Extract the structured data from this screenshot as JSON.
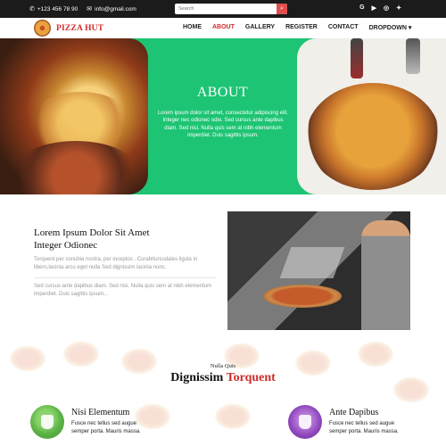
{
  "topbar": {
    "phone": "+123 456 78 90",
    "email": "info@gmail.com",
    "search_placeholder": "Search",
    "social": [
      "G",
      "▶",
      "◎",
      "✦"
    ]
  },
  "brand": {
    "name": "PIZZA HUT"
  },
  "nav": {
    "items": [
      "HOME",
      "ABOUT",
      "GALLERY",
      "REGISTER",
      "CONTACT",
      "DROPDOWN"
    ],
    "active": "ABOUT"
  },
  "hero": {
    "title": "ABOUT",
    "text": "Lorem ipsum dolor sit amet, consectetur adipiscing elit. Integer nec odionec odio. Sed cursus ante dapibus diam. Sed nisi. Nulla quis sem at nibh elementum imperdiet. Duis sagittis ipsum."
  },
  "about": {
    "heading_line1": "Lorem Ipsum Dolor Sit Amet",
    "heading_line2": "Integer Odionec",
    "para1": "Torquent per conubia nostra, per inceptos . Curabitursodales ligula in libero,lacinia arcu eget nulla Sed dignissim lacinia nunc.",
    "para2": "Sed cursus ante dapibus diam. Sed nisi. Nulla quis sem at nibh elementum imperdiet. Duis sagittis ipsum..."
  },
  "section2": {
    "kicker": "Nulla Quis",
    "title_main": "Dignissim ",
    "title_accent": "Torquent",
    "features": [
      {
        "title": "Nisi Elementum",
        "text": "Fusce nec tellus sed augue semper porta. Mauris massa."
      },
      {
        "title": "Ante Dapibus",
        "text": "Fusce nec tellus sed augue semper porta. Mauris massa."
      }
    ]
  },
  "colors": {
    "accent_red": "#d12b2b",
    "hero_green": "#1dc473",
    "topbar_bg": "#1b1b1b"
  }
}
